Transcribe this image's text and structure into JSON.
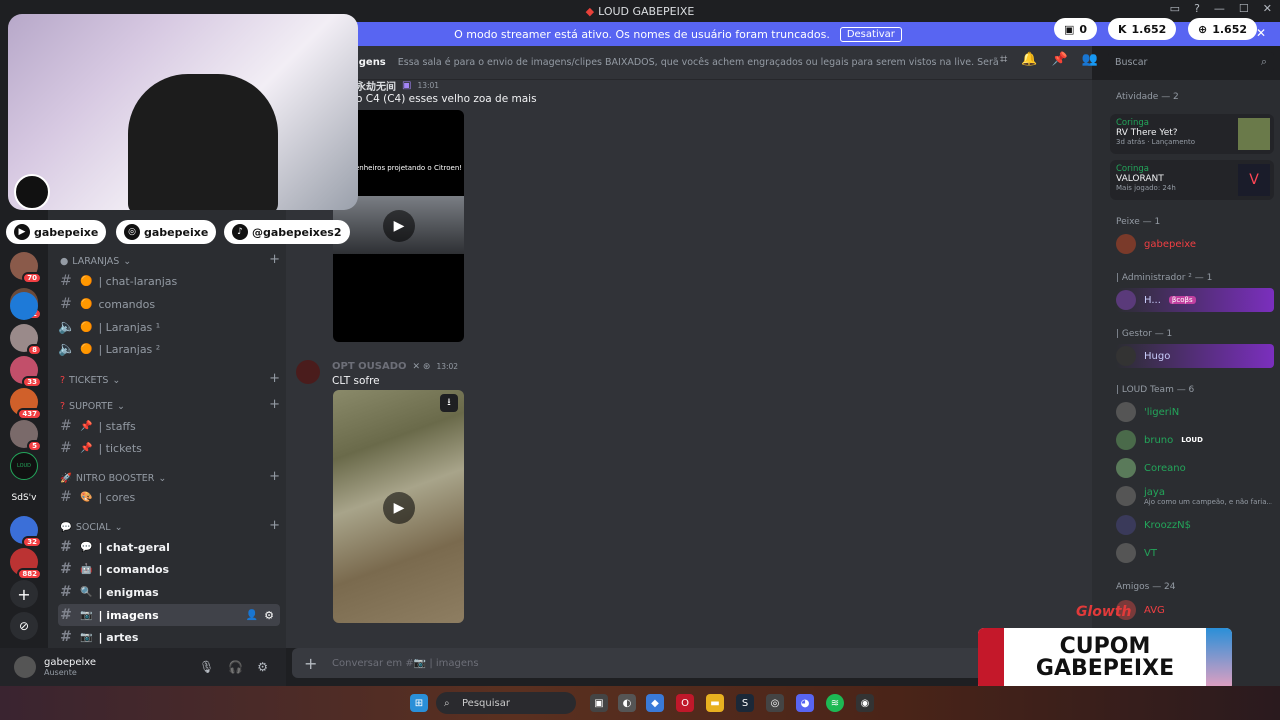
{
  "window": {
    "title": "LOUD GABEPEIXE"
  },
  "streamer_bar": {
    "text": "O modo streamer está ativo. Os nomes de usuário foram truncados.",
    "button": "Desativar"
  },
  "pills": {
    "points": "0",
    "k_value": "1.652",
    "globe_value": "1.652"
  },
  "rail": {
    "servers": [
      {
        "badge": "70"
      },
      {
        "badge": "132"
      },
      {
        "badge": ""
      },
      {
        "badge": "8"
      },
      {
        "badge": "33"
      },
      {
        "badge": "437"
      },
      {
        "badge": "5"
      },
      {
        "label": "LOUD"
      },
      {
        "label": "SdS'v"
      },
      {
        "badge": "32"
      },
      {
        "badge": "882"
      }
    ]
  },
  "channels": {
    "categories": {
      "laranjas": "LARANJAS",
      "tickets": "TICKETS",
      "suporte": "SUPORTE",
      "nitro": "NITRO BOOSTER",
      "social": "SOCIAL"
    },
    "items": {
      "chat_laranjas": "| chat-laranjas",
      "comandos1": "comandos",
      "laranjas1": "| Laranjas ¹",
      "laranjas2": "| Laranjas ²",
      "staffs": "| staffs",
      "tickets": "| tickets",
      "cores": "| cores",
      "chat_geral": "| chat-geral",
      "comandos2": "| comandos",
      "enigmas": "| enigmas",
      "imagens": "| imagens",
      "artes": "| artes"
    }
  },
  "user": {
    "name": "gabepeixe",
    "status": "Ausente"
  },
  "topic": {
    "channel": "agens",
    "text": "Essa sala é para o envio de imagens/clipes BAIXADOS, que vocês achem engraçados ou legais para serem vistos na live. Serão apagados prints de ou..."
  },
  "search": {
    "placeholder": "Buscar"
  },
  "messages": [
    {
      "author": "永劫无间",
      "time": "13:01",
      "text": "o C4 (C4) esses velho zoa de mais",
      "video_caption": "enheiros projetando o Citroen!"
    },
    {
      "author": "OPT OUSADO",
      "time": "13:02",
      "text": "CLT sofre"
    }
  ],
  "composer": {
    "placeholder": "Conversar em #📷 | imagens"
  },
  "members": {
    "activity_header": "Atividade — 2",
    "activities": [
      {
        "user": "Coringa",
        "game": "RV There Yet?",
        "meta1": "3d atrás",
        "meta2": "Lançamento"
      },
      {
        "user": "Coringa",
        "game": "VALORANT",
        "meta1": "Mais jogado: 24h",
        "meta2": ""
      }
    ],
    "groups": [
      {
        "header": "Peixe — 1",
        "members": [
          {
            "name": "gabepeixe",
            "color": "#f23f43"
          }
        ]
      },
      {
        "header": "| Administrador ² — 1",
        "members": [
          {
            "name": "H...",
            "color": "#c9cdfb",
            "tag": "βcοβs"
          }
        ]
      },
      {
        "header": "| Gestor — 1",
        "members": [
          {
            "name": "Hugo",
            "color": "#c9cdfb"
          }
        ]
      },
      {
        "header": "| LOUD Team — 6",
        "members": [
          {
            "name": "'ligeriN",
            "color": "#23a55a"
          },
          {
            "name": "bruno",
            "color": "#23a55a",
            "tag": "LOUD"
          },
          {
            "name": "Coreano",
            "color": "#23a55a"
          },
          {
            "name": "jaya",
            "color": "#23a55a",
            "sub": "Ajo como um campeão, e não faria..."
          },
          {
            "name": "KroozzN$",
            "color": "#23a55a"
          },
          {
            "name": "VT",
            "color": "#23a55a"
          }
        ]
      },
      {
        "header": "Amigos — 24",
        "members": [
          {
            "name": "AVG",
            "color": "#f23f43"
          }
        ]
      }
    ]
  },
  "overlay": {
    "socials": [
      {
        "icon": "youtube-icon",
        "label": "gabepeixe"
      },
      {
        "icon": "instagram-icon",
        "label": "gabepeixe"
      },
      {
        "icon": "tiktok-icon",
        "label": "@gabepeixes2"
      }
    ],
    "coupon_line1": "CUPOM",
    "coupon_line2": "GABEPEIXE",
    "brand": "Glowth"
  },
  "taskbar": {
    "search_placeholder": "Pesquisar"
  },
  "colors": {
    "accent": "#5865f2",
    "bg_chat": "#313338",
    "bg_sidebar": "#2b2d31",
    "bg_dark": "#1e1f22"
  }
}
